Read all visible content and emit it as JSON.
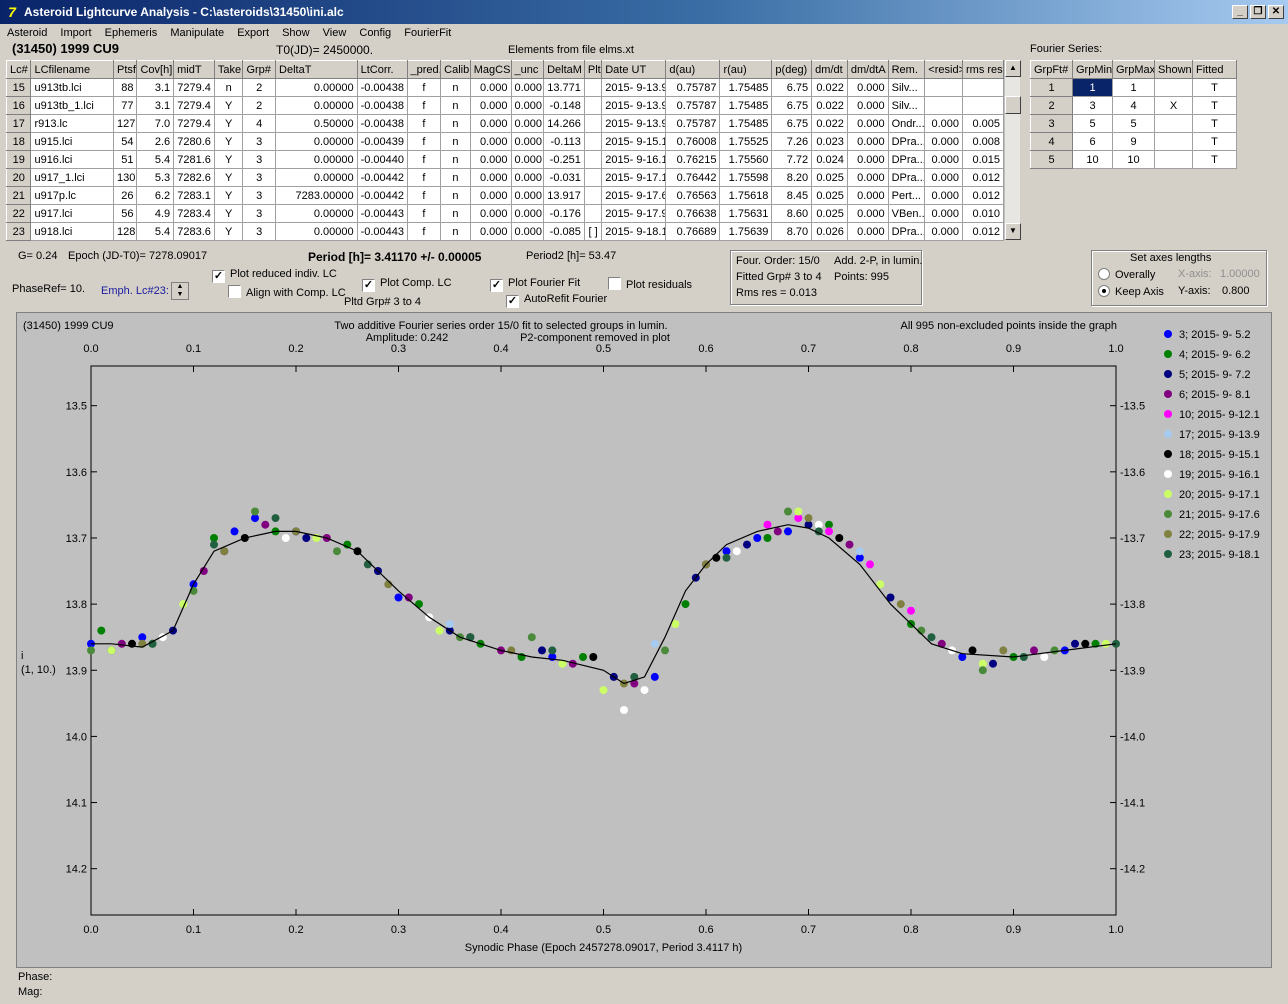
{
  "window": {
    "title": "Asteroid Lightcurve Analysis - C:\\asteroids\\31450\\ini.alc",
    "app_icon": "lightcurve-app-icon"
  },
  "menu": [
    "Asteroid",
    "Import",
    "Ephemeris",
    "Manipulate",
    "Export",
    "Show",
    "View",
    "Config",
    "FourierFit"
  ],
  "header": {
    "asteroid": "(31450) 1999 CU9",
    "t0": "T0(JD)= 2450000.",
    "elements": "Elements from file elms.xt"
  },
  "lc_table": {
    "columns": [
      "Lc#",
      "LCfilename",
      "Ptsf",
      "Cov[h]",
      "midT",
      "Take",
      "Grp#",
      "DeltaT",
      "LtCorr.",
      "_pred.",
      "Calib.",
      "MagCS",
      "_unc",
      "DeltaM",
      "Plt",
      "Date UT",
      "d(au)",
      "r(au)",
      "p(deg)",
      "dm/dt",
      "dm/dtA",
      "Rem.",
      "<resid>",
      "rms res"
    ],
    "rows": [
      [
        "15",
        "u913tb.lci",
        "88",
        "3.1",
        "7279.4",
        "n",
        "2",
        "0.00000",
        "-0.00438",
        "f",
        "n",
        "0.000",
        "0.000",
        "13.771",
        "",
        "2015- 9-13.9",
        "0.75787",
        "1.75485",
        "6.75",
        "0.022",
        "0.000",
        "Silv...",
        "",
        ""
      ],
      [
        "16",
        "u913tb_1.lci",
        "77",
        "3.1",
        "7279.4",
        "Y",
        "2",
        "0.00000",
        "-0.00438",
        "f",
        "n",
        "0.000",
        "0.000",
        "-0.148",
        "",
        "2015- 9-13.9",
        "0.75787",
        "1.75485",
        "6.75",
        "0.022",
        "0.000",
        "Silv...",
        "",
        ""
      ],
      [
        "17",
        "r913.lc",
        "127",
        "7.0",
        "7279.4",
        "Y",
        "4",
        "0.50000",
        "-0.00438",
        "f",
        "n",
        "0.000",
        "0.000",
        "14.266",
        "",
        "2015- 9-13.9",
        "0.75787",
        "1.75485",
        "6.75",
        "0.022",
        "0.000",
        "Ondr...",
        "0.000",
        "0.005"
      ],
      [
        "18",
        "u915.lci",
        "54",
        "2.6",
        "7280.6",
        "Y",
        "3",
        "0.00000",
        "-0.00439",
        "f",
        "n",
        "0.000",
        "0.000",
        "-0.113",
        "",
        "2015- 9-15.1",
        "0.76008",
        "1.75525",
        "7.26",
        "0.023",
        "0.000",
        "DPra...",
        "0.000",
        "0.008"
      ],
      [
        "19",
        "u916.lci",
        "51",
        "5.4",
        "7281.6",
        "Y",
        "3",
        "0.00000",
        "-0.00440",
        "f",
        "n",
        "0.000",
        "0.000",
        "-0.251",
        "",
        "2015- 9-16.1",
        "0.76215",
        "1.75560",
        "7.72",
        "0.024",
        "0.000",
        "DPra...",
        "0.000",
        "0.015"
      ],
      [
        "20",
        "u917_1.lci",
        "130",
        "5.3",
        "7282.6",
        "Y",
        "3",
        "0.00000",
        "-0.00442",
        "f",
        "n",
        "0.000",
        "0.000",
        "-0.031",
        "",
        "2015- 9-17.1",
        "0.76442",
        "1.75598",
        "8.20",
        "0.025",
        "0.000",
        "DPra...",
        "0.000",
        "0.012"
      ],
      [
        "21",
        "u917p.lc",
        "26",
        "6.2",
        "7283.1",
        "Y",
        "3",
        "7283.00000",
        "-0.00442",
        "f",
        "n",
        "0.000",
        "0.000",
        "13.917",
        "",
        "2015- 9-17.6",
        "0.76563",
        "1.75618",
        "8.45",
        "0.025",
        "0.000",
        "Pert...",
        "0.000",
        "0.012"
      ],
      [
        "22",
        "u917.lci",
        "56",
        "4.9",
        "7283.4",
        "Y",
        "3",
        "0.00000",
        "-0.00443",
        "f",
        "n",
        "0.000",
        "0.000",
        "-0.176",
        "",
        "2015- 9-17.9",
        "0.76638",
        "1.75631",
        "8.60",
        "0.025",
        "0.000",
        "VBen...",
        "0.000",
        "0.010"
      ],
      [
        "23",
        "u918.lci",
        "128",
        "5.4",
        "7283.6",
        "Y",
        "3",
        "0.00000",
        "-0.00443",
        "f",
        "n",
        "0.000",
        "0.000",
        "-0.085",
        "[ ]",
        "2015- 9-18.1",
        "0.76689",
        "1.75639",
        "8.70",
        "0.026",
        "0.000",
        "DPra...",
        "0.000",
        "0.012"
      ]
    ]
  },
  "fourier_table": {
    "caption": "Fourier Series:",
    "columns": [
      "GrpFt#",
      "GrpMin",
      "GrpMax",
      "Shown",
      "Fitted"
    ],
    "rows": [
      [
        "1",
        "1",
        "1",
        "",
        "T"
      ],
      [
        "2",
        "3",
        "4",
        "X",
        "T"
      ],
      [
        "3",
        "5",
        "5",
        "",
        "T"
      ],
      [
        "4",
        "6",
        "9",
        "",
        "T"
      ],
      [
        "5",
        "10",
        "10",
        "",
        "T"
      ]
    ]
  },
  "controls": {
    "g": "G= 0.24",
    "epoch": "Epoch (JD-T0)= 7278.09017",
    "period": "Period [h]= 3.41170 +/- 0.00005",
    "period2": "Period2 [h]= 53.47",
    "phaseref": "PhaseRef= 10.",
    "emph": "Emph. Lc#23:",
    "plot_reduced": "Plot reduced indiv. LC",
    "align_comp": "Align with Comp. LC",
    "plot_comp": "Plot Comp. LC",
    "pltd_grp": "Pltd Grp#  3   to   4",
    "plot_fourier": "Plot Fourier Fit",
    "autorefit": "AutoRefit Fourier",
    "plot_residuals": "Plot residuals"
  },
  "info_box": {
    "order": "Four. Order: 15/0",
    "add": "Add. 2-P, in lumin.",
    "fitted": "Fitted Grp# 3 to 4",
    "points": "Points: 995",
    "rms": "Rms res     = 0.013"
  },
  "axes_box": {
    "title": "Set axes lengths",
    "overally": "Overally",
    "keep": "Keep Axis",
    "x_label": "X-axis:",
    "x_val": "1.00000",
    "y_label": "Y-axis:",
    "y_val": "0.800"
  },
  "plot": {
    "left_title": "(31450) 1999 CU9",
    "center_title1": "Two additive Fourier series order 15/0 fit to selected groups in lumin.",
    "center_title2": "Amplitude: 0.242",
    "center_title3": "P2-component removed in plot",
    "right_title": "All 995 non-excluded points inside the graph",
    "ylabel_a": "i",
    "ylabel_b": "(1, 10.)",
    "xlabel": "Synodic Phase (Epoch 2457278.09017, Period 3.4117 h)",
    "x_ticks": [
      "0.0",
      "0.1",
      "0.2",
      "0.3",
      "0.4",
      "0.5",
      "0.6",
      "0.7",
      "0.8",
      "0.9",
      "1.0"
    ],
    "y_ticks": [
      "13.5",
      "13.6",
      "13.7",
      "13.8",
      "13.9",
      "14.0",
      "14.1",
      "14.2"
    ],
    "legend": [
      {
        "label": "3; 2015- 9- 5.2",
        "color": "#0000ff"
      },
      {
        "label": "4; 2015- 9- 6.2",
        "color": "#008000"
      },
      {
        "label": "5; 2015- 9- 7.2",
        "color": "#000080"
      },
      {
        "label": "6; 2015- 9- 8.1",
        "color": "#800080"
      },
      {
        "label": "10; 2015- 9-12.1",
        "color": "#ff00ff"
      },
      {
        "label": "17; 2015- 9-13.9",
        "color": "#a6caf0"
      },
      {
        "label": "18; 2015- 9-15.1",
        "color": "#000000"
      },
      {
        "label": "19; 2015- 9-16.1",
        "color": "#ffffff"
      },
      {
        "label": "20; 2015- 9-17.1",
        "color": "#ccff66"
      },
      {
        "label": "21; 2015- 9-17.6",
        "color": "#4a8a3a"
      },
      {
        "label": "22; 2015- 9-17.9",
        "color": "#808040"
      },
      {
        "label": "23; 2015- 9-18.1",
        "color": "#206040"
      }
    ]
  },
  "chart_data": {
    "type": "scatter",
    "title": "Two additive Fourier series order 15/0 fit to selected groups in lumin.",
    "xlabel": "Synodic Phase (Epoch 2457278.09017, Period 3.4117 h)",
    "ylabel": "i",
    "xlim": [
      0.0,
      1.0
    ],
    "ylim": [
      14.27,
      13.44
    ],
    "y_inverted": true,
    "grid": false,
    "legend_position": "right",
    "fit_curve": {
      "x": [
        0.0,
        0.02,
        0.05,
        0.08,
        0.1,
        0.12,
        0.15,
        0.18,
        0.2,
        0.23,
        0.26,
        0.3,
        0.33,
        0.36,
        0.4,
        0.43,
        0.46,
        0.5,
        0.52,
        0.54,
        0.56,
        0.58,
        0.6,
        0.62,
        0.65,
        0.68,
        0.7,
        0.72,
        0.75,
        0.78,
        0.82,
        0.85,
        0.9,
        0.95,
        1.0
      ],
      "y": [
        13.86,
        13.86,
        13.865,
        13.84,
        13.77,
        13.72,
        13.7,
        13.69,
        13.69,
        13.7,
        13.72,
        13.78,
        13.82,
        13.85,
        13.87,
        13.88,
        13.885,
        13.9,
        13.92,
        13.91,
        13.85,
        13.78,
        13.74,
        13.71,
        13.69,
        13.68,
        13.685,
        13.7,
        13.74,
        13.8,
        13.86,
        13.875,
        13.88,
        13.87,
        13.86
      ]
    },
    "series": [
      {
        "name": "3; 2015- 9- 5.2",
        "points": [
          [
            0.0,
            13.86
          ],
          [
            0.05,
            13.85
          ],
          [
            0.1,
            13.77
          ],
          [
            0.14,
            13.69
          ],
          [
            0.16,
            13.67
          ],
          [
            0.2,
            13.69
          ],
          [
            0.3,
            13.79
          ],
          [
            0.45,
            13.88
          ],
          [
            0.55,
            13.91
          ],
          [
            0.62,
            13.72
          ],
          [
            0.65,
            13.7
          ],
          [
            0.68,
            13.69
          ],
          [
            0.75,
            13.73
          ],
          [
            0.85,
            13.88
          ],
          [
            0.95,
            13.87
          ]
        ]
      },
      {
        "name": "4; 2015- 9- 6.2",
        "points": [
          [
            0.01,
            13.84
          ],
          [
            0.06,
            13.86
          ],
          [
            0.12,
            13.7
          ],
          [
            0.18,
            13.69
          ],
          [
            0.25,
            13.71
          ],
          [
            0.32,
            13.8
          ],
          [
            0.38,
            13.86
          ],
          [
            0.42,
            13.88
          ],
          [
            0.48,
            13.88
          ],
          [
            0.58,
            13.8
          ],
          [
            0.66,
            13.7
          ],
          [
            0.72,
            13.68
          ],
          [
            0.8,
            13.83
          ],
          [
            0.9,
            13.88
          ],
          [
            0.98,
            13.86
          ]
        ]
      },
      {
        "name": "5; 2015- 9- 7.2",
        "points": [
          [
            0.02,
            13.87
          ],
          [
            0.08,
            13.84
          ],
          [
            0.13,
            13.72
          ],
          [
            0.21,
            13.7
          ],
          [
            0.28,
            13.75
          ],
          [
            0.35,
            13.84
          ],
          [
            0.44,
            13.87
          ],
          [
            0.51,
            13.91
          ],
          [
            0.59,
            13.76
          ],
          [
            0.64,
            13.71
          ],
          [
            0.7,
            13.68
          ],
          [
            0.78,
            13.79
          ],
          [
            0.88,
            13.89
          ],
          [
            0.96,
            13.86
          ]
        ]
      },
      {
        "name": "6; 2015- 9- 8.1",
        "points": [
          [
            0.03,
            13.86
          ],
          [
            0.11,
            13.75
          ],
          [
            0.17,
            13.68
          ],
          [
            0.23,
            13.7
          ],
          [
            0.31,
            13.79
          ],
          [
            0.4,
            13.87
          ],
          [
            0.47,
            13.89
          ],
          [
            0.53,
            13.92
          ],
          [
            0.6,
            13.74
          ],
          [
            0.67,
            13.69
          ],
          [
            0.74,
            13.71
          ],
          [
            0.83,
            13.86
          ],
          [
            0.92,
            13.87
          ]
        ]
      },
      {
        "name": "10; 2015- 9-12.1",
        "points": [
          [
            0.66,
            13.68
          ],
          [
            0.69,
            13.67
          ],
          [
            0.72,
            13.69
          ],
          [
            0.76,
            13.74
          ],
          [
            0.8,
            13.81
          ]
        ]
      },
      {
        "name": "17; 2015- 9-13.9",
        "points": [
          [
            0.15,
            13.7
          ],
          [
            0.35,
            13.83
          ],
          [
            0.55,
            13.86
          ],
          [
            0.75,
            13.72
          ]
        ]
      },
      {
        "name": "18; 2015- 9-15.1",
        "points": [
          [
            0.04,
            13.86
          ],
          [
            0.15,
            13.7
          ],
          [
            0.26,
            13.72
          ],
          [
            0.37,
            13.85
          ],
          [
            0.49,
            13.88
          ],
          [
            0.61,
            13.73
          ],
          [
            0.73,
            13.7
          ],
          [
            0.86,
            13.87
          ],
          [
            0.97,
            13.86
          ]
        ]
      },
      {
        "name": "19; 2015- 9-16.1",
        "points": [
          [
            0.07,
            13.85
          ],
          [
            0.19,
            13.7
          ],
          [
            0.33,
            13.82
          ],
          [
            0.52,
            13.96
          ],
          [
            0.54,
            13.93
          ],
          [
            0.63,
            13.72
          ],
          [
            0.71,
            13.68
          ],
          [
            0.84,
            13.87
          ],
          [
            0.93,
            13.88
          ]
        ]
      },
      {
        "name": "20; 2015- 9-17.1",
        "points": [
          [
            0.02,
            13.87
          ],
          [
            0.09,
            13.8
          ],
          [
            0.22,
            13.7
          ],
          [
            0.34,
            13.84
          ],
          [
            0.46,
            13.89
          ],
          [
            0.5,
            13.93
          ],
          [
            0.57,
            13.83
          ],
          [
            0.69,
            13.66
          ],
          [
            0.77,
            13.77
          ],
          [
            0.87,
            13.89
          ],
          [
            0.99,
            13.86
          ]
        ]
      },
      {
        "name": "21; 2015- 9-17.6",
        "points": [
          [
            0.0,
            13.87
          ],
          [
            0.1,
            13.78
          ],
          [
            0.16,
            13.66
          ],
          [
            0.24,
            13.72
          ],
          [
            0.36,
            13.85
          ],
          [
            0.43,
            13.85
          ],
          [
            0.56,
            13.87
          ],
          [
            0.68,
            13.66
          ],
          [
            0.81,
            13.84
          ],
          [
            0.87,
            13.9
          ],
          [
            0.94,
            13.87
          ]
        ]
      },
      {
        "name": "22; 2015- 9-17.9",
        "points": [
          [
            0.05,
            13.86
          ],
          [
            0.13,
            13.72
          ],
          [
            0.2,
            13.69
          ],
          [
            0.29,
            13.77
          ],
          [
            0.41,
            13.87
          ],
          [
            0.52,
            13.92
          ],
          [
            0.6,
            13.74
          ],
          [
            0.7,
            13.67
          ],
          [
            0.79,
            13.8
          ],
          [
            0.89,
            13.87
          ]
        ]
      },
      {
        "name": "23; 2015- 9-18.1",
        "points": [
          [
            0.06,
            13.86
          ],
          [
            0.12,
            13.71
          ],
          [
            0.18,
            13.67
          ],
          [
            0.27,
            13.74
          ],
          [
            0.37,
            13.85
          ],
          [
            0.45,
            13.87
          ],
          [
            0.53,
            13.91
          ],
          [
            0.62,
            13.73
          ],
          [
            0.71,
            13.69
          ],
          [
            0.82,
            13.85
          ],
          [
            0.91,
            13.88
          ],
          [
            1.0,
            13.86
          ]
        ]
      }
    ]
  },
  "status": {
    "phase": "Phase:",
    "mag": "Mag:"
  }
}
